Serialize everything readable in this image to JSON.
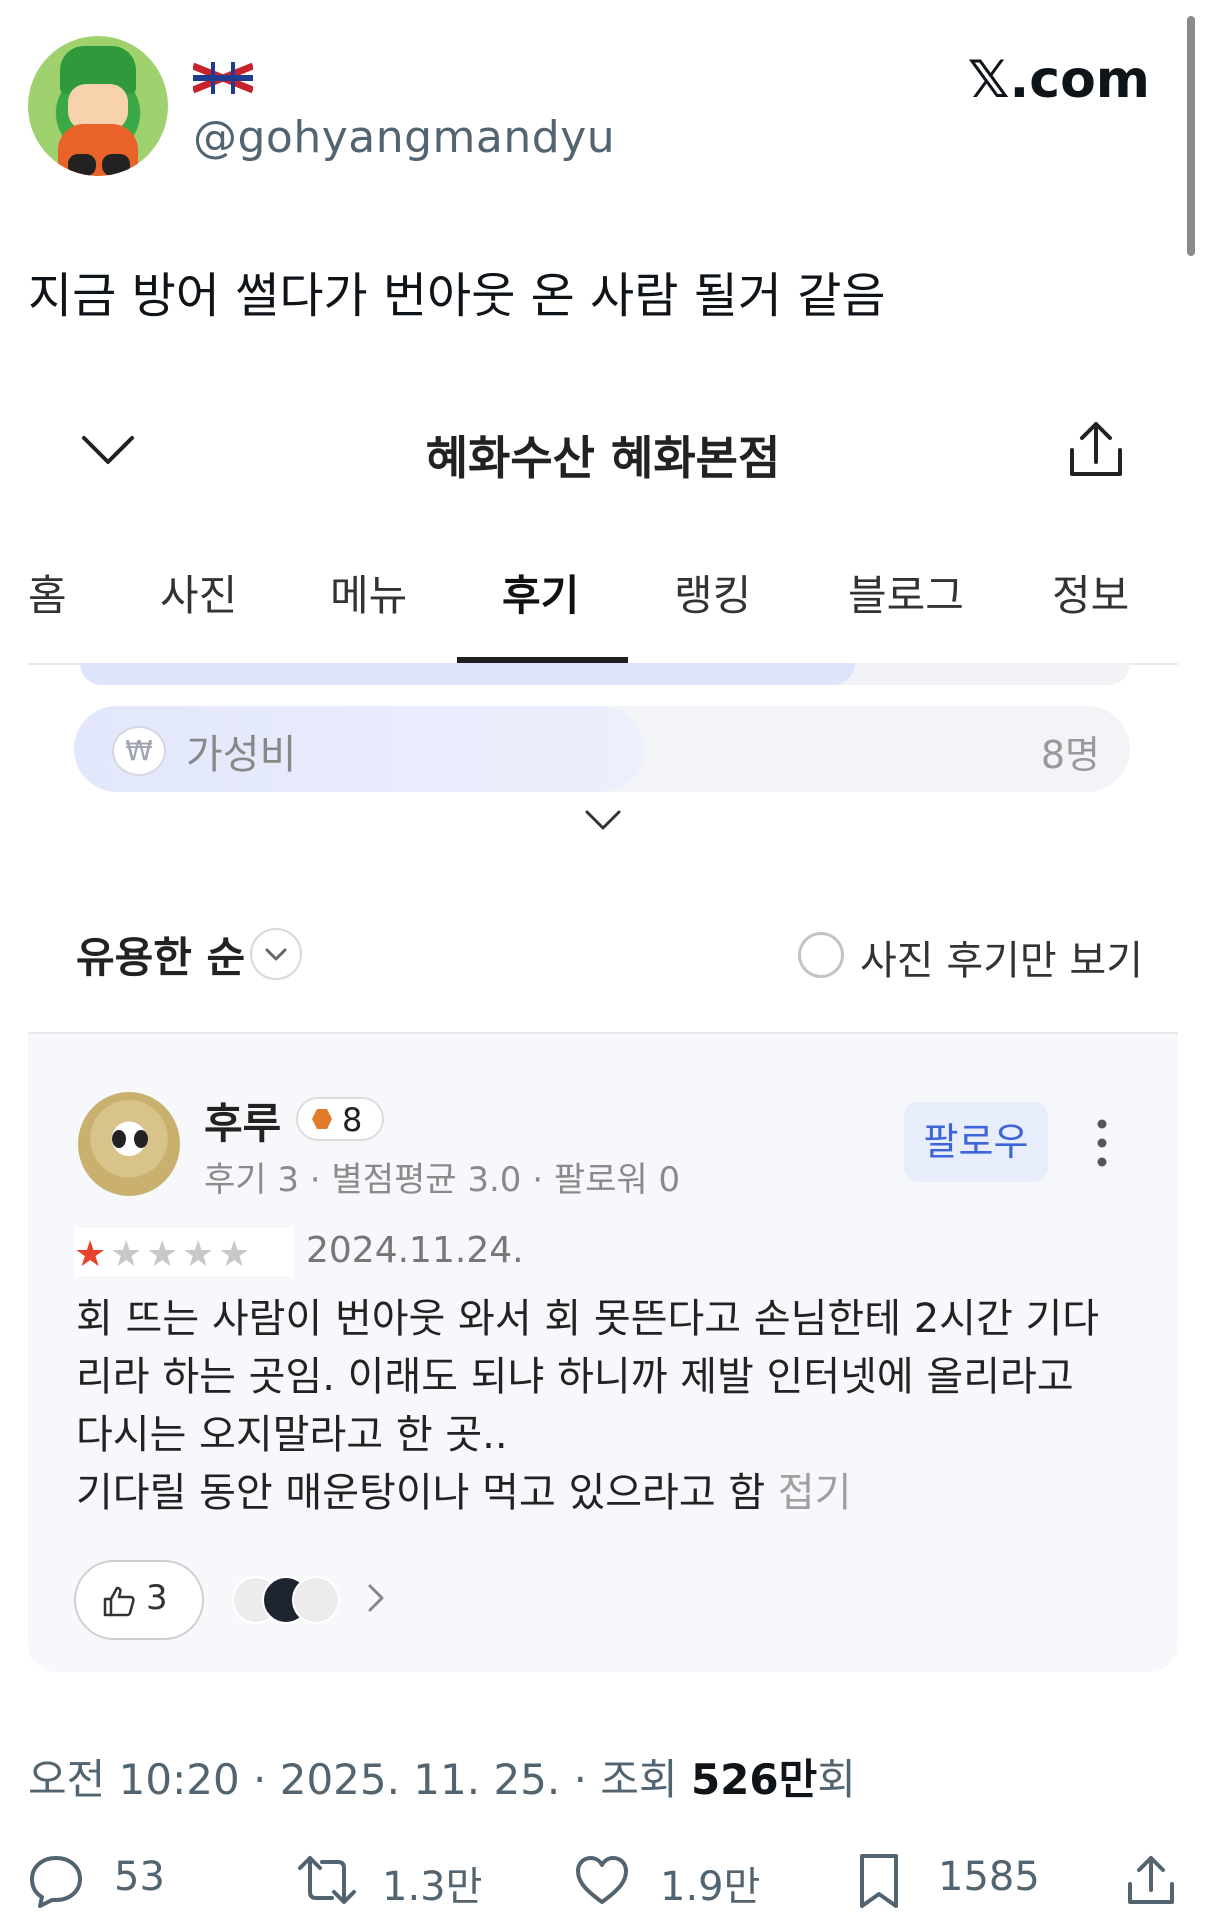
{
  "tweet": {
    "handle": "@gohyangmandyu",
    "brand": "𝕏.com",
    "text": "지금 방어 썰다가 번아웃 온 사람 될거 같음",
    "timestamp_prefix": "오전 10:20 · 2025. 11. 25. · 조회 ",
    "views": "526만",
    "views_suffix": "회",
    "actions": {
      "replies": "53",
      "retweets": "1.3만",
      "likes": "1.9만",
      "bookmarks": "1585"
    }
  },
  "store": {
    "title": "혜화수산 혜화본점",
    "tabs": [
      "홈",
      "사진",
      "메뉴",
      "후기",
      "랭킹",
      "블로그",
      "정보"
    ],
    "active_tab": "후기",
    "keyword": {
      "icon": "₩",
      "label": "가성비",
      "count": "8명",
      "fill_fraction": 0.54
    },
    "sort_label": "유용한 순",
    "photo_only_label": "사진 후기만 보기"
  },
  "review": {
    "name": "후루",
    "badge_level": "8",
    "meta": "후기 3 · 별점평균 3.0 · 팔로워 0",
    "follow_label": "팔로우",
    "rating": 1,
    "rating_max": 5,
    "date": "2024.11.24.",
    "body_lines": [
      "회 뜨는 사람이 번아웃 와서 회 못뜬다고 손님한테 2시간 기다",
      "리라 하는 곳임. 이래도 되냐 하니까 제발 인터넷에 올리라고",
      "다시는 오지말라고 한 곳..",
      "기다릴 동안 매운탕이나 먹고 있으라고 함 "
    ],
    "fold_label": "접기",
    "likes": "3"
  },
  "colors": {
    "accent_blue": "#3d64d8",
    "star_red": "#e8412c",
    "muted_text": "#536471"
  }
}
